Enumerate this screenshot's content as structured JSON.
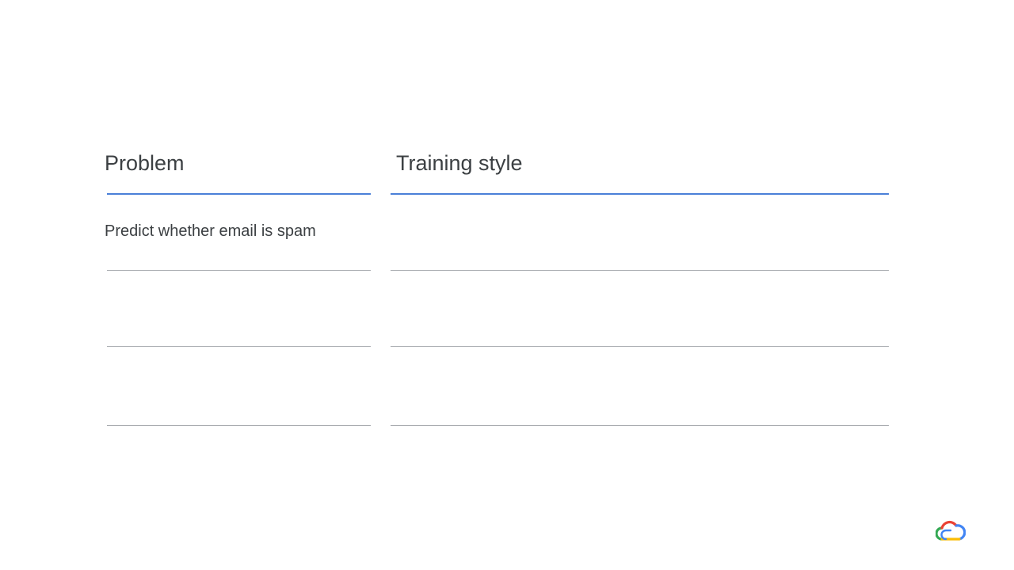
{
  "table": {
    "headers": [
      "Problem",
      "Training style"
    ],
    "rows": [
      {
        "problem": "Predict whether email is spam",
        "training_style": ""
      },
      {
        "problem": "",
        "training_style": ""
      },
      {
        "problem": "",
        "training_style": ""
      }
    ]
  },
  "colors": {
    "header_rule": "#4a80d8",
    "row_rule": "#a9acb0",
    "text": "#3c4043"
  },
  "logo": {
    "icon": "google-cloud-logo-icon"
  }
}
